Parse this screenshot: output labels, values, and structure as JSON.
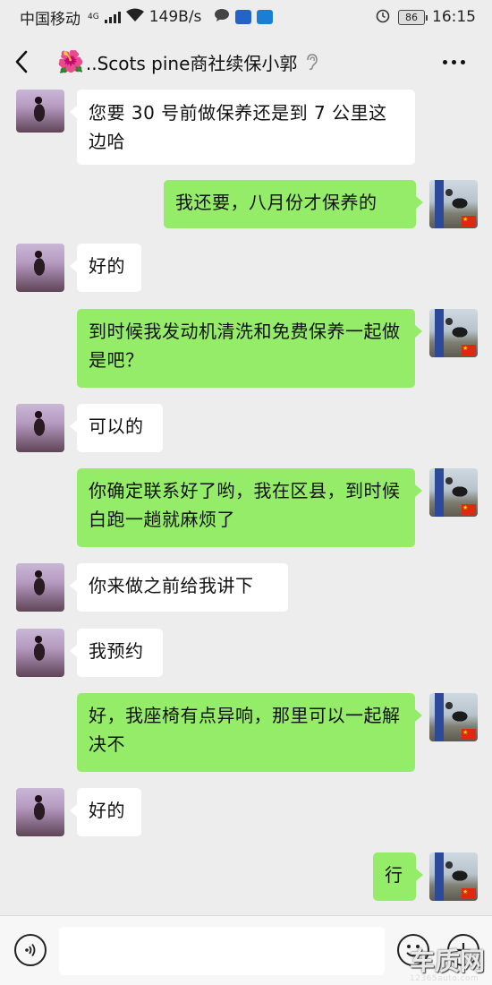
{
  "status_bar": {
    "carrier": "中国移动",
    "network": "4G",
    "speed": "149B/s",
    "battery": "86",
    "time": "16:15",
    "icons": [
      "signal-icon",
      "wifi-icon",
      "chat-notification-icon",
      "app-notification-icon",
      "shield-notification-icon",
      "alarm-icon",
      "battery-icon"
    ]
  },
  "nav": {
    "title": "..Scots pine商社续保小郭",
    "title_emoji": "🌺",
    "icons": [
      "back-icon",
      "mute-ear-icon",
      "more-icon"
    ]
  },
  "messages": [
    {
      "side": "left",
      "text": "您要 30 号前做保养还是到 7 公里这边哈"
    },
    {
      "side": "right",
      "text": "我还要，八月份才保养的"
    },
    {
      "side": "left",
      "text": "好的"
    },
    {
      "side": "right",
      "text": "到时候我发动机清洗和免费保养一起做是吧？"
    },
    {
      "side": "left",
      "text": "可以的"
    },
    {
      "side": "right",
      "text": "你确定联系好了哟，我在区县，到时候白跑一趟就麻烦了"
    },
    {
      "side": "left",
      "text": "你来做之前给我讲下"
    },
    {
      "side": "left",
      "text": "我预约"
    },
    {
      "side": "right",
      "text": "好，我座椅有点异响，那里可以一起解决不"
    },
    {
      "side": "left",
      "text": "好的"
    },
    {
      "side": "right",
      "text": "行"
    }
  ],
  "input_bar": {
    "value": "",
    "icons": [
      "voice-icon",
      "emoji-icon",
      "plus-icon"
    ]
  },
  "watermark": {
    "brand": "车质网",
    "url": "12365auto.com"
  },
  "colors": {
    "background": "#ededed",
    "bubble_self": "#95ec69",
    "bubble_other": "#ffffff"
  }
}
